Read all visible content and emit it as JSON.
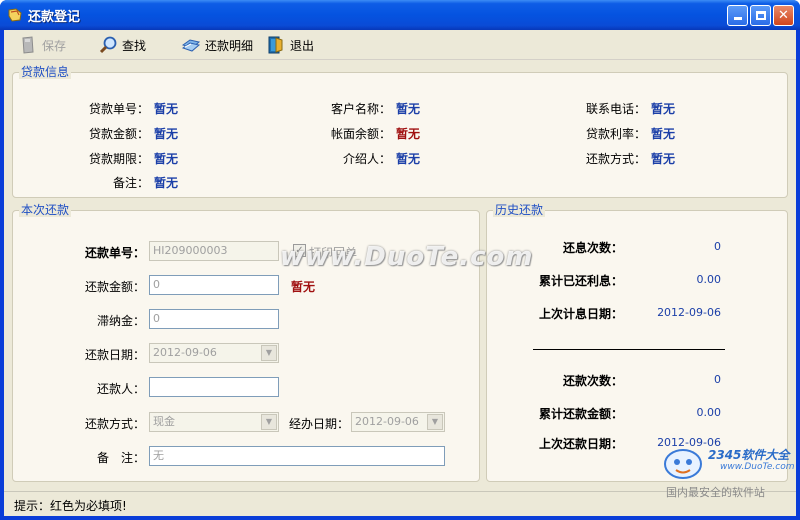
{
  "window": {
    "title": "还款登记"
  },
  "toolbar": {
    "save": "保存",
    "search": "查找",
    "detail": "还款明细",
    "exit": "退出"
  },
  "loan_info": {
    "title": "贷款信息",
    "fields": {
      "loan_no": {
        "label": "贷款单号：",
        "value": "暂无"
      },
      "customer": {
        "label": "客户名称：",
        "value": "暂无"
      },
      "phone": {
        "label": "联系电话：",
        "value": "暂无"
      },
      "amount": {
        "label": "贷款金额：",
        "value": "暂无"
      },
      "balance": {
        "label": "帐面余额：",
        "value": "暂无"
      },
      "rate": {
        "label": "贷款利率：",
        "value": "暂无"
      },
      "term": {
        "label": "贷款期限：",
        "value": "暂无"
      },
      "introducer": {
        "label": "介绍人：",
        "value": "暂无"
      },
      "repay_method": {
        "label": "还款方式：",
        "value": "暂无"
      },
      "note": {
        "label": "备注：",
        "value": "暂无"
      }
    }
  },
  "current": {
    "title": "本次还款",
    "repay_no": {
      "label": "还款单号：",
      "value": "HI209000003"
    },
    "print_receipt": "打印回单",
    "repay_amount": {
      "label": "还款金额：",
      "value": "0",
      "hint": "暂无"
    },
    "late_fee": {
      "label": "滞纳金：",
      "value": "0"
    },
    "repay_date": {
      "label": "还款日期：",
      "value": "2012-09-06"
    },
    "payer": {
      "label": "还款人：",
      "value": ""
    },
    "method": {
      "label": "还款方式：",
      "value": "现金"
    },
    "handle_date": {
      "label": "经办日期：",
      "value": "2012-09-06"
    },
    "remark": {
      "label": "备　注：",
      "value": "无"
    }
  },
  "history": {
    "title": "历史还款",
    "interest_count": {
      "label": "还息次数：",
      "value": "0"
    },
    "interest_total": {
      "label": "累计已还利息：",
      "value": "0.00"
    },
    "last_interest_date": {
      "label": "上次计息日期：",
      "value": "2012-09-06"
    },
    "repay_count": {
      "label": "还款次数：",
      "value": "0"
    },
    "repay_total": {
      "label": "累计还款金额：",
      "value": "0.00"
    },
    "last_repay_date": {
      "label": "上次还款日期：",
      "value": "2012-09-06"
    }
  },
  "status": {
    "text": "提示：红色为必填项!"
  },
  "watermark": "www.DuoTe.com",
  "logo": {
    "line1": "2345软件大全",
    "line2": "www.DuoTe.com",
    "line3": "国内最安全的软件站"
  },
  "colors": {
    "titlebar": "#0553e0",
    "value_blue": "#1b3fa8",
    "value_red": "#a01010",
    "group_title": "#1f4fc4"
  }
}
